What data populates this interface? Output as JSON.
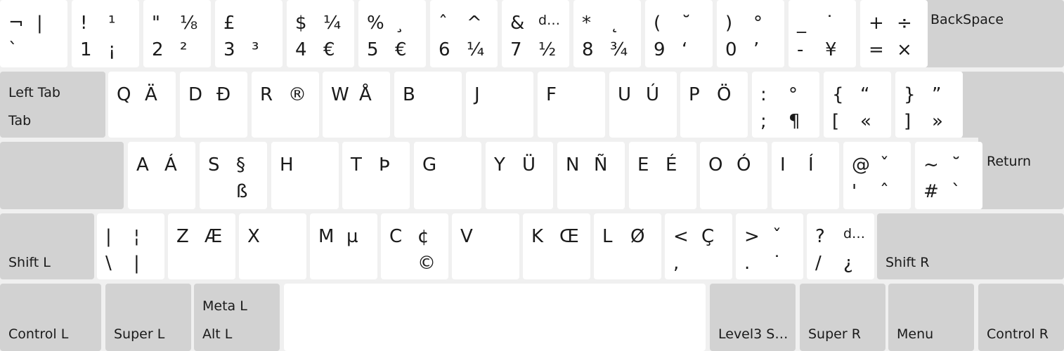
{
  "keyboard": {
    "row1": [
      {
        "name": "key-grave",
        "tl": "¬",
        "tr": "|",
        "bl": "`",
        "br": ""
      },
      {
        "name": "key-1",
        "tl": "!",
        "tr": "¹",
        "bl": "1",
        "br": "¡"
      },
      {
        "name": "key-2",
        "tl": "\"",
        "tr": "⅛",
        "bl": "2",
        "br": "²"
      },
      {
        "name": "key-3",
        "tl": "£",
        "tr": "",
        "bl": "3",
        "br": "³"
      },
      {
        "name": "key-4",
        "tl": "$",
        "tr": "¼",
        "bl": "4",
        "br": "€"
      },
      {
        "name": "key-5",
        "tl": "%",
        "tr": "¸",
        "bl": "5",
        "br": "€"
      },
      {
        "name": "key-6",
        "tl": "ˆ",
        "tr": "^",
        "bl": "6",
        "br": "¼"
      },
      {
        "name": "key-7",
        "tl": "&",
        "tr": "d…",
        "bl": "7",
        "br": "½"
      },
      {
        "name": "key-8",
        "tl": "*",
        "tr": "˛",
        "bl": "8",
        "br": "¾"
      },
      {
        "name": "key-9",
        "tl": "(",
        "tr": "˘",
        "bl": "9",
        "br": "‘"
      },
      {
        "name": "key-0",
        "tl": ")",
        "tr": "°",
        "bl": "0",
        "br": "’"
      },
      {
        "name": "key-minus",
        "tl": "_",
        "tr": "˙",
        "bl": "-",
        "br": "¥"
      },
      {
        "name": "key-equal",
        "tl": "+",
        "tr": "÷",
        "bl": "=",
        "br": "×"
      }
    ],
    "backspace": "BackSpace",
    "tab_top": "Left Tab",
    "tab_bottom": "Tab",
    "row2": [
      {
        "name": "key-q",
        "tl": "Q",
        "tr": "Ä",
        "bl": "",
        "br": ""
      },
      {
        "name": "key-d",
        "tl": "D",
        "tr": "Đ",
        "bl": "",
        "br": ""
      },
      {
        "name": "key-r",
        "tl": "R",
        "tr": "®",
        "bl": "",
        "br": ""
      },
      {
        "name": "key-w",
        "tl": "W",
        "tr": "Å",
        "bl": "",
        "br": ""
      },
      {
        "name": "key-b",
        "tl": "B",
        "tr": "",
        "bl": "",
        "br": ""
      },
      {
        "name": "key-j",
        "tl": "J",
        "tr": "",
        "bl": "",
        "br": ""
      },
      {
        "name": "key-f",
        "tl": "F",
        "tr": "",
        "bl": "",
        "br": ""
      },
      {
        "name": "key-u",
        "tl": "U",
        "tr": "Ú",
        "bl": "",
        "br": ""
      },
      {
        "name": "key-p",
        "tl": "P",
        "tr": "Ö",
        "bl": "",
        "br": ""
      },
      {
        "name": "key-semicolon",
        "tl": ":",
        "tr": "°",
        "bl": ";",
        "br": "¶"
      },
      {
        "name": "key-bracketleft",
        "tl": "{",
        "tr": "“",
        "bl": "[",
        "br": "«"
      },
      {
        "name": "key-bracketright",
        "tl": "}",
        "tr": "”",
        "bl": "]",
        "br": "»"
      }
    ],
    "return": "Return",
    "row3": [
      {
        "name": "key-a",
        "tl": "A",
        "tr": "Á",
        "bl": "",
        "br": ""
      },
      {
        "name": "key-s",
        "tl": "S",
        "tr": "§",
        "bl": "",
        "br": "ß"
      },
      {
        "name": "key-h",
        "tl": "H",
        "tr": "",
        "bl": "",
        "br": ""
      },
      {
        "name": "key-t",
        "tl": "T",
        "tr": "Þ",
        "bl": "",
        "br": ""
      },
      {
        "name": "key-g",
        "tl": "G",
        "tr": "",
        "bl": "",
        "br": ""
      },
      {
        "name": "key-y",
        "tl": "Y",
        "tr": "Ü",
        "bl": "",
        "br": ""
      },
      {
        "name": "key-n",
        "tl": "N",
        "tr": "Ñ",
        "bl": "",
        "br": ""
      },
      {
        "name": "key-e",
        "tl": "E",
        "tr": "É",
        "bl": "",
        "br": ""
      },
      {
        "name": "key-o",
        "tl": "O",
        "tr": "Ó",
        "bl": "",
        "br": ""
      },
      {
        "name": "key-i",
        "tl": "I",
        "tr": "Í",
        "bl": "",
        "br": ""
      },
      {
        "name": "key-apostrophe",
        "tl": "@",
        "tr": "ˇ",
        "bl": "'",
        "br": "ˆ"
      },
      {
        "name": "key-numbersign",
        "tl": "~",
        "tr": "˘",
        "bl": "#",
        "br": "`"
      }
    ],
    "shift_left": "Shift L",
    "row4": [
      {
        "name": "key-backslash",
        "tl": "|",
        "tr": "¦",
        "bl": "\\",
        "br": "|"
      },
      {
        "name": "key-z",
        "tl": "Z",
        "tr": "Æ",
        "bl": "",
        "br": ""
      },
      {
        "name": "key-x",
        "tl": "X",
        "tr": "",
        "bl": "",
        "br": ""
      },
      {
        "name": "key-m",
        "tl": "M",
        "tr": "µ",
        "bl": "",
        "br": ""
      },
      {
        "name": "key-c",
        "tl": "C",
        "tr": "¢",
        "bl": "",
        "br": "©"
      },
      {
        "name": "key-v",
        "tl": "V",
        "tr": "",
        "bl": "",
        "br": ""
      },
      {
        "name": "key-k",
        "tl": "K",
        "tr": "Œ",
        "bl": "",
        "br": ""
      },
      {
        "name": "key-l",
        "tl": "L",
        "tr": "Ø",
        "bl": "",
        "br": ""
      },
      {
        "name": "key-comma",
        "tl": "<",
        "tr": "Ç",
        "bl": ",",
        "br": ""
      },
      {
        "name": "key-period",
        "tl": ">",
        "tr": "ˇ",
        "bl": ".",
        "br": "˙"
      },
      {
        "name": "key-slash",
        "tl": "?",
        "tr": "d…",
        "bl": "/",
        "br": "¿"
      }
    ],
    "shift_right": "Shift R",
    "control_left": "Control L",
    "super_left": "Super L",
    "meta_left": "Meta L",
    "alt_left": "Alt L",
    "level3": "Level3 S…",
    "super_right": "Super R",
    "menu": "Menu",
    "control_right": "Control R"
  },
  "colors": {
    "background": "#f0f0f0",
    "key": "#ffffff",
    "modifier_key": "#d2d2d2",
    "text": "#1a1a1a"
  }
}
